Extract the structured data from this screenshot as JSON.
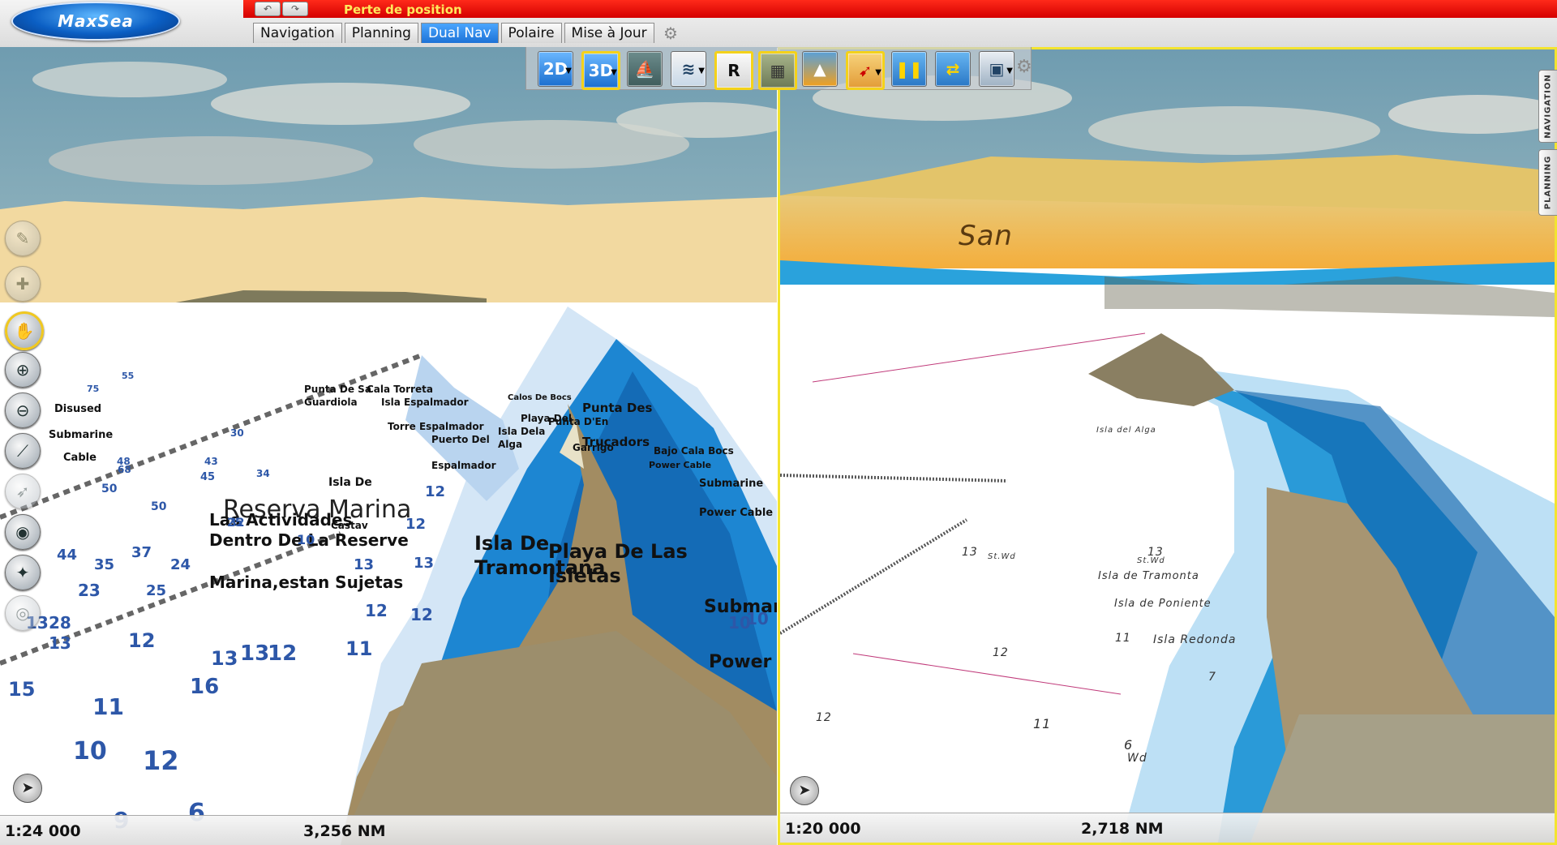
{
  "app": {
    "logo_text": "MaxSea",
    "status": "Perte de position",
    "undo_icons": [
      "undo-icon",
      "redo-icon"
    ]
  },
  "tabs": [
    {
      "label": "Navigation",
      "active": false
    },
    {
      "label": "Planning",
      "active": false
    },
    {
      "label": "Dual Nav",
      "active": true
    },
    {
      "label": "Polaire",
      "active": false
    },
    {
      "label": "Mise à Jour",
      "active": false
    }
  ],
  "toolbar": {
    "buttons": [
      {
        "name": "2d-view-button",
        "label": "2D",
        "icon": "boat-2d-icon"
      },
      {
        "name": "3d-view-button",
        "label": "3D",
        "icon": "boat-3d-icon"
      },
      {
        "name": "head-up-button",
        "label": "",
        "icon": "boat-heading-icon"
      },
      {
        "name": "chart-type-button",
        "label": "",
        "icon": "nautical-chart-icon"
      },
      {
        "name": "raster-button",
        "label": "R",
        "icon": "raster-icon"
      },
      {
        "name": "photo-fusion-button",
        "label": "",
        "icon": "satellite-photo-icon"
      },
      {
        "name": "relief-button",
        "label": "",
        "icon": "relief-shading-icon"
      },
      {
        "name": "exaggeration-button",
        "label": "",
        "icon": "boat-exaggeration-icon"
      },
      {
        "name": "tide-button",
        "label": "",
        "icon": "tide-gauge-icon"
      },
      {
        "name": "current-button",
        "label": "",
        "icon": "current-arrows-icon"
      },
      {
        "name": "overlay-button",
        "label": "",
        "icon": "image-overlay-icon"
      }
    ],
    "settings_icon": "gears-icon"
  },
  "left_tools": [
    "route-icon",
    "mark-icon",
    "pan-hand-icon",
    "zoom-in-icon",
    "zoom-out-icon",
    "ruler-icon",
    "heading-icon",
    "center-boat-icon",
    "compass-rose-icon",
    "ebl-vrm-icon"
  ],
  "left_pane": {
    "scale": "1:24 000",
    "distance": "3,256 NM",
    "big_labels": [
      "Reserva Marina",
      "Las Actividades",
      "Dentro De La Reserve",
      "Marina,estan Sujetas",
      "Isla De",
      "Tramontana",
      "Playa De Las",
      "Isletas",
      "Submarine",
      "Power Cable"
    ],
    "labels": [
      "Disused",
      "Submarine",
      "Cable",
      "Punta De Sa",
      "Guardiola",
      "Cala Torreta",
      "Isla Espalmador",
      "Torre Espalmador",
      "Puerto Del",
      "Espalmador",
      "Isla Dela",
      "Alga",
      "Playa Del",
      "Punta D'En",
      "Garrigo",
      "Punta Des",
      "Trucadors",
      "Bajo Cala Bocs",
      "Power Cable",
      "Submarine",
      "Isla De",
      "Castav",
      "Calos De Bocs",
      "Power Cable"
    ],
    "depths": [
      "75",
      "55",
      "30",
      "43",
      "50",
      "34",
      "48",
      "68",
      "50",
      "45",
      "25",
      "32",
      "44",
      "35",
      "24",
      "37",
      "25",
      "23",
      "28",
      "13",
      "13",
      "12",
      "13",
      "15",
      "16",
      "13",
      "12",
      "11",
      "11",
      "10",
      "12",
      "12",
      "12",
      "10",
      "9",
      "6",
      "10",
      "13",
      "12",
      "12",
      "10",
      "13",
      "9"
    ]
  },
  "right_pane": {
    "scale": "1:20 000",
    "distance": "2,718 NM",
    "place_labels": [
      "San",
      "Isla de Tramonta",
      "Isla de Poniente",
      "Isla Redonda",
      "Isla del Alga"
    ],
    "soundings": [
      "13",
      "13",
      "12",
      "11",
      "12",
      "11",
      "7",
      "6",
      "Wd",
      "St.Wd",
      "St.Wd"
    ]
  },
  "side_tabs": [
    "NAVIGATION",
    "PLANNING"
  ],
  "colors": {
    "status_bar": "#e00000",
    "active_tab": "#1d72d6",
    "sky": "#6f9cb0",
    "land": "#f2d9a0",
    "deep_blue": "#1678c8",
    "shallow": "#bcd8f0",
    "highlight": "#f3e430"
  }
}
